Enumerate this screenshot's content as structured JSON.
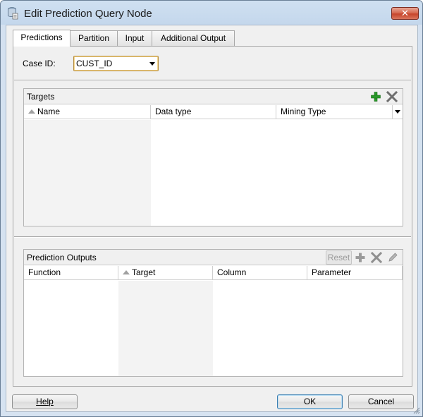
{
  "window": {
    "title": "Edit Prediction Query Node",
    "close_glyph": "✕"
  },
  "tabs": [
    {
      "label": "Predictions",
      "active": true
    },
    {
      "label": "Partition",
      "active": false
    },
    {
      "label": "Input",
      "active": false
    },
    {
      "label": "Additional Output",
      "active": false
    }
  ],
  "case_id": {
    "label": "Case ID:",
    "value": "CUST_ID"
  },
  "targets": {
    "title": "Targets",
    "columns": [
      "Name",
      "Data type",
      "Mining Type"
    ],
    "rows": []
  },
  "prediction_outputs": {
    "title": "Prediction Outputs",
    "reset_label": "Reset",
    "columns": [
      "Function",
      "Target",
      "Column",
      "Parameter"
    ],
    "rows": []
  },
  "footer": {
    "help_label": "Help",
    "ok_label": "OK",
    "cancel_label": "Cancel"
  },
  "colors": {
    "add_icon": "#2a9a2a",
    "delete_icon": "#6f6f6f",
    "disabled_icon": "#9a9a9a",
    "default_button_border": "#3c7fb1"
  }
}
